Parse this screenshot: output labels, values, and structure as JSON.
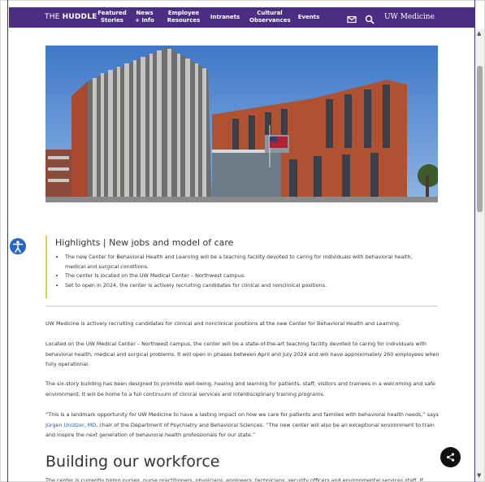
{
  "nav": {
    "brand_pre": "THE ",
    "brand_bold": "HUDDLE",
    "items": [
      {
        "line1": "Featured",
        "line2": "Stories"
      },
      {
        "line1": "News",
        "line2": "+ Info"
      },
      {
        "line1": "Employee",
        "line2": "Resources"
      },
      {
        "line1": "Intranets",
        "line2": ""
      },
      {
        "line1": "Cultural",
        "line2": "Observances"
      },
      {
        "line1": "Events",
        "line2": ""
      }
    ],
    "uw_logo": "UW Medicine",
    "icons": [
      "mail-icon",
      "search-icon"
    ]
  },
  "hero": {
    "alt": "Center for Behavioral Health and Learning building"
  },
  "highlights": {
    "title": "Highlights | New jobs and model of care",
    "bullets": [
      "The new Center for Behavioral Health and Learning will be a teaching facility devoted to caring for individuals with behavioral health, medical and surgical conditions.",
      "The center is located on the UW Medical Center – Northwest campus.",
      "Set to open in 2024, the center is actively recruiting candidates for clinical and nonclinical positions."
    ]
  },
  "body": {
    "p1": "UW Medicine is actively recruiting candidates for clinical and nonclinical positions at the new Center for Behavioral Health and Learning.",
    "p2": "Located on the UW Medical Center – Northwest campus, the center will be a state-of-the-art teaching facility devoted to caring for individuals with behavioral health, medical and surgical problems. It will open in phases between April and July 2024 and will have approximately 260 employees when fully operational.",
    "p3": "The six-story building has been designed to promote well-being, healing and learning for patients, staff, visitors and trainees in a welcoming and safe environment. It will be home to a full continuum of clinical services and interdisciplinary training programs.",
    "p4_quote": "“This is a landmark opportunity for UW Medicine to have a lasting impact on how we care for patients and families with behavioral health needs,”",
    "p4_says": " says ",
    "p4_link": "Jürgen Unützer, MD",
    "p4_rest": ", chair of the Department of Psychiatry and Behavioral Sciences. “The new center will also be an exceptional environment to train and inspire the next generation of behavioral health professionals for our state.”",
    "h2": "Building our workforce",
    "p5": "The center is currently hiring nurses, nurse practitioners, physicians, engineers, technicians, security officers and environmental services staff. If"
  },
  "colors": {
    "brand_purple": "#4b2e83",
    "highlight_accent": "#f2c94c",
    "link": "#2c5ba8"
  }
}
